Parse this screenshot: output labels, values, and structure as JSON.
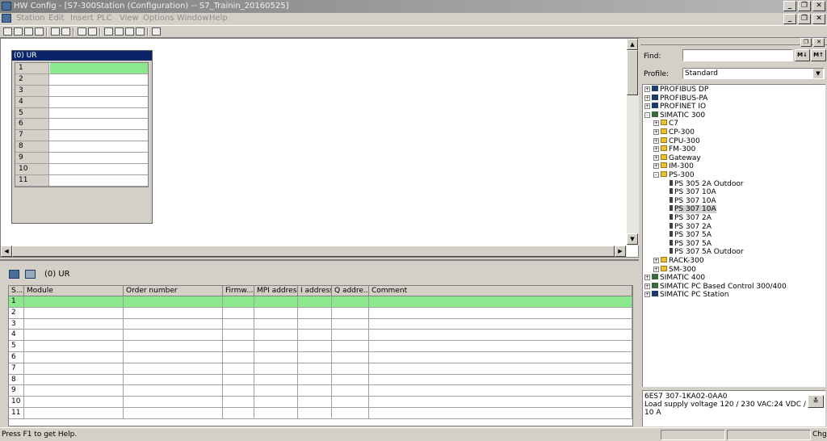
{
  "window": {
    "title": "HW Config - [S7-300Station (Configuration) -- S7_Trainin_20160525]",
    "minimize": "_",
    "restore": "❐",
    "close": "✕"
  },
  "menu": [
    "Station",
    "Edit",
    "Insert",
    "PLC",
    "View",
    "Options",
    "Window",
    "Help"
  ],
  "station": {
    "rack_title": "(0) UR",
    "slots": [
      "1",
      "2",
      "3",
      "4",
      "5",
      "6",
      "7",
      "8",
      "9",
      "10",
      "11"
    ],
    "selected_slot": "1"
  },
  "detail": {
    "rack_label": "(0)  UR",
    "columns": [
      "S...",
      "Module",
      "Order number",
      "Firmw...",
      "MPI address",
      "I address",
      "Q addre...",
      "Comment"
    ],
    "rows": [
      "1",
      "2",
      "3",
      "4",
      "5",
      "6",
      "7",
      "8",
      "9",
      "10",
      "11"
    ]
  },
  "catalog": {
    "find_label": "Find:",
    "find_value": "",
    "profile_label": "Profile:",
    "profile_value": "Standard",
    "tree": [
      {
        "label": "PROFIBUS DP",
        "level": 0,
        "exp": "+",
        "icon": "network-icon"
      },
      {
        "label": "PROFIBUS-PA",
        "level": 0,
        "exp": "+",
        "icon": "network-icon"
      },
      {
        "label": "PROFINET IO",
        "level": 0,
        "exp": "+",
        "icon": "network-icon"
      },
      {
        "label": "SIMATIC 300",
        "level": 0,
        "exp": "-",
        "icon": "rack-icon"
      },
      {
        "label": "C7",
        "level": 1,
        "exp": "+",
        "icon": "folder-icon"
      },
      {
        "label": "CP-300",
        "level": 1,
        "exp": "+",
        "icon": "folder-icon"
      },
      {
        "label": "CPU-300",
        "level": 1,
        "exp": "+",
        "icon": "folder-icon"
      },
      {
        "label": "FM-300",
        "level": 1,
        "exp": "+",
        "icon": "folder-icon"
      },
      {
        "label": "Gateway",
        "level": 1,
        "exp": "+",
        "icon": "folder-icon"
      },
      {
        "label": "IM-300",
        "level": 1,
        "exp": "+",
        "icon": "folder-icon"
      },
      {
        "label": "PS-300",
        "level": 1,
        "exp": "-",
        "icon": "folder-icon"
      },
      {
        "label": "PS 305 2A Outdoor",
        "level": 2,
        "exp": "",
        "icon": "module-icon"
      },
      {
        "label": "PS 307 10A",
        "level": 2,
        "exp": "",
        "icon": "module-icon"
      },
      {
        "label": "PS 307 10A",
        "level": 2,
        "exp": "",
        "icon": "module-icon"
      },
      {
        "label": "PS 307 10A",
        "level": 2,
        "exp": "",
        "icon": "module-icon",
        "selected": true
      },
      {
        "label": "PS 307 2A",
        "level": 2,
        "exp": "",
        "icon": "module-icon"
      },
      {
        "label": "PS 307 2A",
        "level": 2,
        "exp": "",
        "icon": "module-icon"
      },
      {
        "label": "PS 307 5A",
        "level": 2,
        "exp": "",
        "icon": "module-icon"
      },
      {
        "label": "PS 307 5A",
        "level": 2,
        "exp": "",
        "icon": "module-icon"
      },
      {
        "label": "PS 307 5A Outdoor",
        "level": 2,
        "exp": "",
        "icon": "module-icon"
      },
      {
        "label": "RACK-300",
        "level": 1,
        "exp": "+",
        "icon": "folder-icon"
      },
      {
        "label": "SM-300",
        "level": 1,
        "exp": "+",
        "icon": "folder-icon"
      },
      {
        "label": "SIMATIC 400",
        "level": 0,
        "exp": "+",
        "icon": "rack-icon"
      },
      {
        "label": "SIMATIC PC Based Control 300/400",
        "level": 0,
        "exp": "+",
        "icon": "rack-icon"
      },
      {
        "label": "SIMATIC PC Station",
        "level": 0,
        "exp": "+",
        "icon": "pc-icon"
      }
    ],
    "info_line1": "6ES7 307-1KA02-0AA0",
    "info_line2": "Load supply voltage 120 / 230 VAC:24 VDC / 10 A"
  },
  "status": {
    "text": "Press F1 to get Help.",
    "mode": "Chg"
  },
  "colors": {
    "selection_green": "#8ce88c",
    "title_blue": "#0a246a"
  }
}
